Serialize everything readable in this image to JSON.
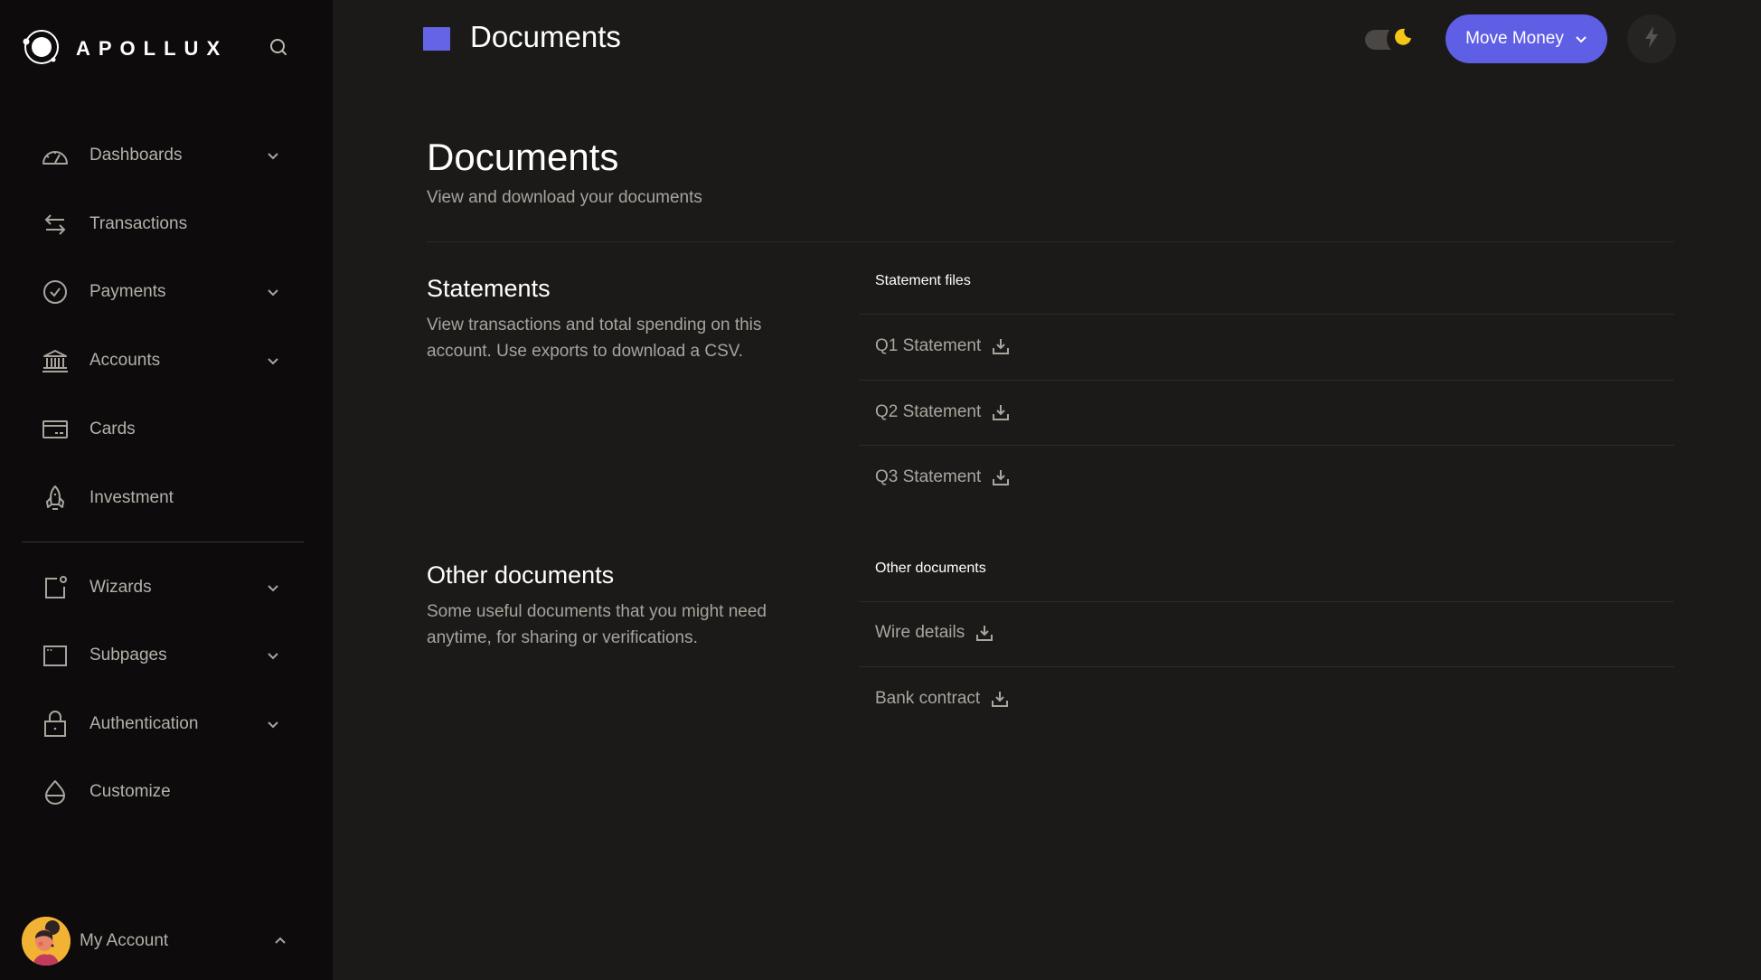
{
  "brand": {
    "name": "APOLLUX",
    "logo_icon": "orbit-logo-icon"
  },
  "search": {
    "icon": "search-icon"
  },
  "sidebar": {
    "items": [
      {
        "label": "Dashboards",
        "icon": "gauge-icon",
        "expandable": true
      },
      {
        "label": "Transactions",
        "icon": "arrows-swap-icon",
        "expandable": false
      },
      {
        "label": "Payments",
        "icon": "check-circle-icon",
        "expandable": true
      },
      {
        "label": "Accounts",
        "icon": "bank-icon",
        "expandable": true
      },
      {
        "label": "Cards",
        "icon": "credit-card-icon",
        "expandable": false
      },
      {
        "label": "Investment",
        "icon": "rocket-icon",
        "expandable": false
      },
      {
        "label": "Wizards",
        "icon": "wizard-icon",
        "expandable": true
      },
      {
        "label": "Subpages",
        "icon": "window-icon",
        "expandable": true
      },
      {
        "label": "Authentication",
        "icon": "lock-icon",
        "expandable": true
      },
      {
        "label": "Customize",
        "icon": "droplet-icon",
        "expandable": false
      }
    ],
    "account": {
      "label": "My Account",
      "expanded": true
    }
  },
  "header": {
    "title": "Documents",
    "theme": "dark",
    "move_money_label": "Move Money"
  },
  "page": {
    "title": "Documents",
    "subtitle": "View and download your documents"
  },
  "sections": [
    {
      "title": "Statements",
      "description_lines": [
        "View transactions and total spending on this",
        "account. Use exports to download a CSV."
      ],
      "list_header": "Statement files",
      "files": [
        "Q1 Statement",
        "Q2 Statement",
        "Q3 Statement"
      ]
    },
    {
      "title": "Other documents",
      "description_lines": [
        "Some useful documents that you might need",
        "anytime, for sharing or verifications."
      ],
      "list_header": "Other documents",
      "files": [
        "Wire details",
        "Bank contract"
      ]
    }
  ],
  "colors": {
    "accent": "#5f5fe6",
    "sidebar_bg": "#0d0b0b",
    "main_bg": "#1b1a19",
    "moon": "#f5c518"
  }
}
